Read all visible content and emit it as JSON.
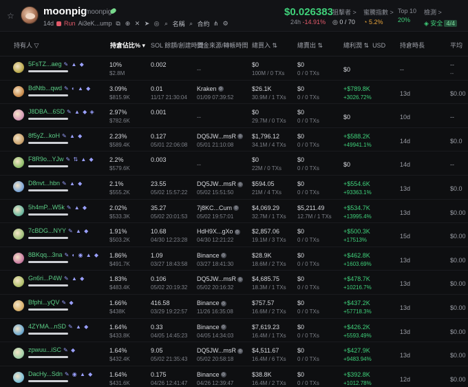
{
  "header": {
    "token_name": "moonpig",
    "ticker": "moonpig",
    "age": "14d",
    "run_label": "Run",
    "contract": "Ai3eK...ump",
    "link_name": "名稱",
    "link_contract": "合約",
    "price": "$0.026383",
    "change_label": "24h",
    "change_value": "-14.91%",
    "stats": [
      {
        "label": "狙擊者 >",
        "value": "0 / 70"
      },
      {
        "label": "蜜騰指數 >",
        "value": "5.2%"
      },
      {
        "label": "Top 10",
        "value": "20%"
      },
      {
        "label": "檢測 >",
        "value": "安全",
        "badge": "4/4"
      }
    ]
  },
  "columns": {
    "holder": "持有人",
    "pct": "持倉佔比%",
    "sol": "SOL 餘額/創建時間",
    "source": "資金來源/轉帳時間",
    "bought": "總買入",
    "sold": "總賣出",
    "pnl": "總利潤",
    "usd": "USD",
    "hold": "持倉時長",
    "avg": "平均"
  },
  "rows": [
    {
      "addr": "5FsTZ...aeg",
      "icons": "✎ ▲ ◆",
      "pct": "10%",
      "usd": "$2.8M",
      "sol": "0.002",
      "sol_time": "",
      "src": "--",
      "src_time": "",
      "buy": "$0",
      "buy_sub": "100M / 0 TXs",
      "sell": "$0",
      "sell_sub": "0 / 0 TXs",
      "pnl": "$0",
      "pnl_pct": "",
      "hold": "--",
      "avg": "--",
      "avg2": "--",
      "color": "#b9a84a"
    },
    {
      "addr": "BdNtb...qwd",
      "icons": "✎ ◐ ▲ ◆",
      "pct": "3.09%",
      "usd": "$815.9K",
      "sol": "0.01",
      "sol_time": "11/17 21:30:04",
      "src": "Kraken",
      "src_time": "01/09 07:39:52",
      "buy": "$26.1K",
      "buy_sub": "30.9M / 1 TXs",
      "sell": "$0",
      "sell_sub": "0 / 0 TXs",
      "pnl": "+$789.8K",
      "pnl_pct": "+3026.72%",
      "hold": "13d",
      "avg": "$0.00",
      "avg2": "",
      "color": "#c98a4a"
    },
    {
      "addr": "J8DBA...6SD",
      "icons": "✎ ▲ ◆ ◈",
      "pct": "2.97%",
      "usd": "$782.6K",
      "sol": "0.001",
      "sol_time": "",
      "src": "--",
      "src_time": "",
      "buy": "$0",
      "buy_sub": "29.7M / 0 TXs",
      "sell": "$0",
      "sell_sub": "0 / 0 TXs",
      "pnl": "$0",
      "pnl_pct": "",
      "hold": "10d",
      "avg": "--",
      "avg2": "",
      "color": "#d79ab8"
    },
    {
      "addr": "8f5yZ...koH",
      "icons": "✎ ▲ ◆",
      "pct": "2.23%",
      "usd": "$589.4K",
      "sol": "0.127",
      "sol_time": "05/01 22:06:08",
      "src": "DQ5JW...msR",
      "src_time": "05/01 21:10:08",
      "buy": "$1,796.12",
      "buy_sub": "34.1M / 4 TXs",
      "sell": "$0",
      "sell_sub": "0 / 0 TXs",
      "pnl": "+$588.2K",
      "pnl_pct": "+49941.1%",
      "hold": "14d",
      "avg": "$0.0",
      "avg2": "",
      "color": "#c9a06a"
    },
    {
      "addr": "F8R9o...YJw",
      "icons": "✎ ⇅ ▲ ◆",
      "pct": "2.2%",
      "usd": "$579.6K",
      "sol": "0.003",
      "sol_time": "",
      "src": "--",
      "src_time": "",
      "buy": "$0",
      "buy_sub": "22M / 0 TXs",
      "sell": "$0",
      "sell_sub": "0 / 0 TXs",
      "pnl": "$0",
      "pnl_pct": "",
      "hold": "14d",
      "avg": "--",
      "avg2": "",
      "color": "#8fbf6a"
    },
    {
      "addr": "D8nvt...hbn",
      "icons": "✎ ▲ ◆",
      "pct": "2.1%",
      "usd": "$555.2K",
      "sol": "23.55",
      "sol_time": "05/02 15:57:22",
      "src": "DQ5JW...msR",
      "src_time": "05/02 15:51:50",
      "buy": "$594.05",
      "buy_sub": "21M / 4 TXs",
      "sell": "$0",
      "sell_sub": "0 / 0 TXs",
      "pnl": "+$554.6K",
      "pnl_pct": "+93363.1%",
      "hold": "13d",
      "avg": "$0.0",
      "avg2": "",
      "color": "#7aa6d8"
    },
    {
      "addr": "5h4mP...W5k",
      "icons": "✎ ▲ ◆",
      "pct": "2.02%",
      "usd": "$533.3K",
      "sol": "35.27",
      "sol_time": "05/02 20:01:53",
      "src": "7j8KC...Cum",
      "src_time": "05/02 19:57:01",
      "buy": "$4,069.29",
      "buy_sub": "32.7M / 1 TXs",
      "sell": "$5,211.49",
      "sell_sub": "12.7M / 1 TXs",
      "pnl": "+$534.7K",
      "pnl_pct": "+13995.4%",
      "hold": "13d",
      "avg": "$0.00",
      "avg2": "",
      "color": "#6ab8a0"
    },
    {
      "addr": "7cBDG...NYY",
      "icons": "✎ ▲ ◆",
      "pct": "1.91%",
      "usd": "$503.2K",
      "sol": "10.68",
      "sol_time": "04/30 12:23:28",
      "src": "HdH9X...gXo",
      "src_time": "04/30 12:21:22",
      "buy": "$2,857.06",
      "buy_sub": "19.1M / 3 TXs",
      "sell": "$0",
      "sell_sub": "0 / 0 TXs",
      "pnl": "+$500.3K",
      "pnl_pct": "+17513%",
      "hold": "15d",
      "avg": "$0.00",
      "avg2": "",
      "color": "#9fc07a"
    },
    {
      "addr": "8BKqq...3na",
      "icons": "✎ ◐ ◉ ▲ ◆",
      "pct": "1.86%",
      "usd": "$491.7K",
      "sol": "1.09",
      "sol_time": "03/27 18:43:58",
      "src": "Binance",
      "src_time": "03/27 18:41:30",
      "buy": "$28.9K",
      "buy_sub": "18.6M / 2 TXs",
      "sell": "$0",
      "sell_sub": "0 / 0 TXs",
      "pnl": "+$462.8K",
      "pnl_pct": "+1603.69%",
      "hold": "13d",
      "avg": "$0.00",
      "avg2": "",
      "color": "#c87aa0"
    },
    {
      "addr": "Gn6ri...P4W",
      "icons": "✎ ▲ ◆",
      "pct": "1.83%",
      "usd": "$483.4K",
      "sol": "0.106",
      "sol_time": "05/02 20:19:32",
      "src": "DQ5JW...msR",
      "src_time": "05/02 20:16:32",
      "buy": "$4,685.75",
      "buy_sub": "18.3M / 1 TXs",
      "sell": "$0",
      "sell_sub": "0 / 0 TXs",
      "pnl": "+$478.7K",
      "pnl_pct": "+10216.7%",
      "hold": "13d",
      "avg": "$0.00",
      "avg2": "",
      "color": "#b0c06a"
    },
    {
      "addr": "Bfphi...yQV",
      "icons": "✎ ◆",
      "pct": "1.66%",
      "usd": "$438K",
      "sol": "416.58",
      "sol_time": "03/29 19:22:57",
      "src": "Binance",
      "src_time": "11/26 16:35:08",
      "buy": "$757.57",
      "buy_sub": "16.6M / 2 TXs",
      "sell": "$0",
      "sell_sub": "0 / 0 TXs",
      "pnl": "+$437.2K",
      "pnl_pct": "+57718.3%",
      "hold": "13d",
      "avg": "$0.00",
      "avg2": "",
      "color": "#d8b06a"
    },
    {
      "addr": "4ZYMA...nSD",
      "icons": "✎ ▲ ◆",
      "pct": "1.64%",
      "usd": "$433.8K",
      "sol": "0.33",
      "sol_time": "04/05 14:45:23",
      "src": "Binance",
      "src_time": "04/05 14:34:03",
      "buy": "$7,619.23",
      "buy_sub": "16.4M / 1 TXs",
      "sell": "$0",
      "sell_sub": "0 / 0 TXs",
      "pnl": "+$426.2K",
      "pnl_pct": "+5593.49%",
      "hold": "13d",
      "avg": "$0.00",
      "avg2": "",
      "color": "#6aa8d0"
    },
    {
      "addr": "zpwuu...iSC",
      "icons": "✎ ◆",
      "pct": "1.64%",
      "usd": "$432.4K",
      "sol": "9.05",
      "sol_time": "05/02 21:35:43",
      "src": "DQ5JW...msR",
      "src_time": "05/02 20:58:18",
      "buy": "$4,511.67",
      "buy_sub": "16.4M / 6 TXs",
      "sell": "$0",
      "sell_sub": "0 / 0 TXs",
      "pnl": "+$427.9K",
      "pnl_pct": "+9483.94%",
      "hold": "13d",
      "avg": "$0.00",
      "avg2": "",
      "color": "#a0d0a8"
    },
    {
      "addr": "DacHy...Sdn",
      "icons": "✎ ◉ ▲ ◆",
      "pct": "1.64%",
      "usd": "$431.6K",
      "sol": "0.175",
      "sol_time": "04/26 12:41:47",
      "src": "Binance",
      "src_time": "04/26 12:39:47",
      "buy": "$38.8K",
      "buy_sub": "16.4M / 2 TXs",
      "sell": "$0",
      "sell_sub": "0 / 0 TXs",
      "pnl": "+$392.8K",
      "pnl_pct": "+1012.78%",
      "hold": "12d",
      "avg": "$0.00",
      "avg2": "",
      "color": "#7ac0d8"
    }
  ]
}
